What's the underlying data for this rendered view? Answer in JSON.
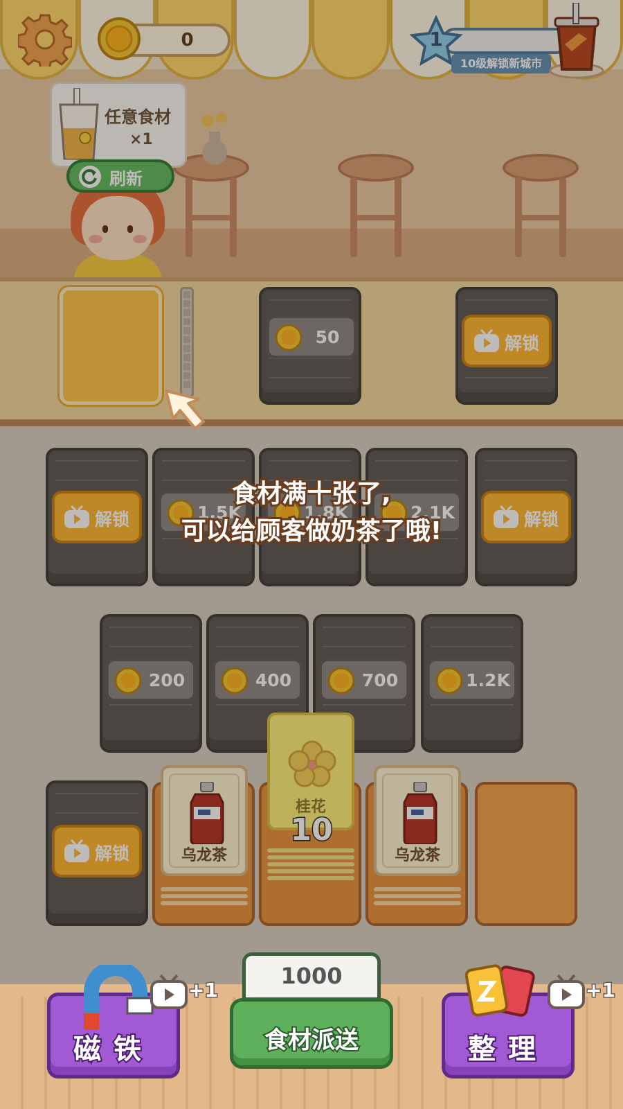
{
  "hud": {
    "coins": "0",
    "level": "1",
    "level_tip": "10级解锁新城市"
  },
  "order": {
    "item_name": "任意食材",
    "quantity": "×1",
    "refresh_label": "刷新"
  },
  "counter": {
    "slot_2_price": "50",
    "slot_3_label": "解锁"
  },
  "board": {
    "row1": [
      {
        "type": "unlock",
        "label": "解锁"
      },
      {
        "type": "price",
        "label": "1.5K"
      },
      {
        "type": "price",
        "label": "1.8K"
      },
      {
        "type": "price",
        "label": "2.1K"
      },
      {
        "type": "unlock",
        "label": "解锁"
      }
    ],
    "row2": [
      {
        "type": "price",
        "label": "200"
      },
      {
        "type": "price",
        "label": "400"
      },
      {
        "type": "price",
        "label": "700"
      },
      {
        "type": "price",
        "label": "1.2K"
      }
    ],
    "row3": {
      "unlock_label": "解锁",
      "stack_1_name": "乌龙茶",
      "stack_2_name": "桂花",
      "stack_2_count": "10",
      "stack_3_name": "乌龙茶"
    }
  },
  "tip": {
    "line1": "食材满十张了,",
    "line2": "可以给顾客做奶茶了哦!"
  },
  "toolbar": {
    "magnet_label": "磁铁",
    "magnet_bonus": "+1",
    "dispatch_cost": "1000",
    "dispatch_label": "食材派送",
    "sort_label": "整理",
    "sort_bonus": "+1"
  },
  "colors": {
    "accent_gold": "#ffc648",
    "unlock_orange": "#ffb72e",
    "locked_gray": "#5a5754",
    "dispatch_green": "#5fb05c",
    "tool_purple": "#a259d4"
  }
}
